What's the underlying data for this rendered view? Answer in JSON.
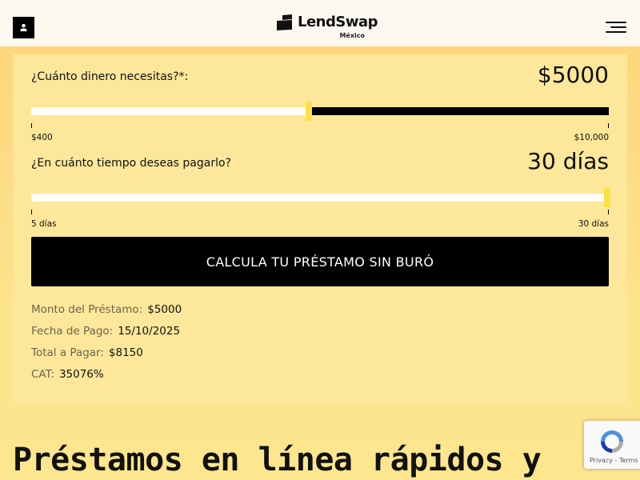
{
  "header": {
    "logo_text": "LendSwap",
    "logo_sub": "México"
  },
  "amount": {
    "label": "¿Cuánto dinero necesitas?*:",
    "value_display": "$5000",
    "min_label": "$400",
    "max_label": "$10,000",
    "fraction": 0.48
  },
  "term": {
    "label": "¿En cuánto tiempo deseas pagarlo?",
    "value_display": "30 días",
    "min_label": "5 días",
    "max_label": "30 días",
    "fraction": 1.0
  },
  "cta_label": "CALCULA TU PRÉSTAMO SIN BURÓ",
  "summary": [
    {
      "label": "Monto del Préstamo:",
      "value": "$5000"
    },
    {
      "label": "Fecha de Pago:",
      "value": "15/10/2025"
    },
    {
      "label": "Total a Pagar:",
      "value": "$8150"
    },
    {
      "label": "CAT:",
      "value": "35076%"
    }
  ],
  "headline": "Préstamos en línea rápidos y",
  "recaptcha": {
    "links": "Privacy - Terms"
  },
  "colors": {
    "accent": "#fde047",
    "background": "#fde48a",
    "card": "#fde79a",
    "cta_bg": "#000000"
  }
}
